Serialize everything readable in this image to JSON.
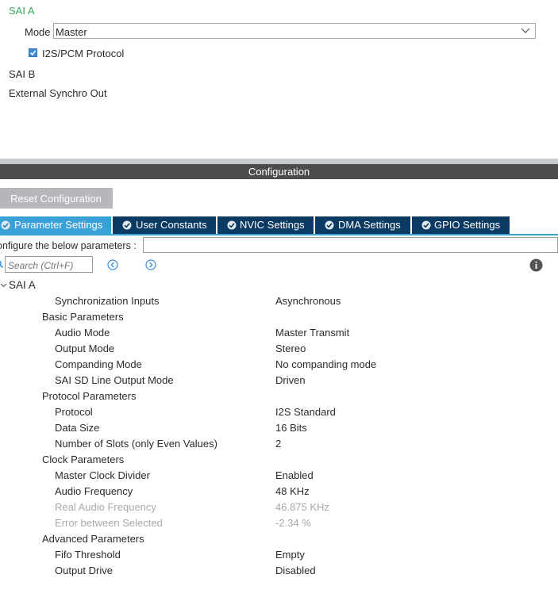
{
  "mode_panel": {
    "title": "SAI A",
    "mode_label": "Mode",
    "mode_value": "Master",
    "protocol_checkbox_label": "I2S/PCM Protocol",
    "protocol_checked": true,
    "sai_b": "SAI B",
    "external_sync": "External Synchro Out"
  },
  "config_bar": {
    "title": "Configuration"
  },
  "reset_button": "Reset Configuration",
  "tabs": [
    {
      "label": "Parameter Settings",
      "active": true
    },
    {
      "label": "User Constants",
      "active": false
    },
    {
      "label": "NVIC Settings",
      "active": false
    },
    {
      "label": "DMA Settings",
      "active": false
    },
    {
      "label": "GPIO Settings",
      "active": false
    }
  ],
  "configure_text": "onfigure the below parameters :",
  "search": {
    "placeholder": "Search (Ctrl+F)"
  },
  "tree": {
    "root": "SAI A",
    "rows": [
      {
        "label": "Synchronization Inputs",
        "value": "Asynchronous",
        "level": 2,
        "disabled": false
      },
      {
        "label": "Basic Parameters",
        "value": "",
        "level": 1,
        "disabled": false
      },
      {
        "label": "Audio Mode",
        "value": "Master Transmit",
        "level": 2,
        "disabled": false
      },
      {
        "label": "Output Mode",
        "value": "Stereo",
        "level": 2,
        "disabled": false
      },
      {
        "label": "Companding Mode",
        "value": "No companding mode",
        "level": 2,
        "disabled": false
      },
      {
        "label": "SAI SD Line Output Mode",
        "value": "Driven",
        "level": 2,
        "disabled": false
      },
      {
        "label": "Protocol Parameters",
        "value": "",
        "level": 1,
        "disabled": false
      },
      {
        "label": "Protocol",
        "value": "I2S Standard",
        "level": 2,
        "disabled": false
      },
      {
        "label": "Data Size",
        "value": "16 Bits",
        "level": 2,
        "disabled": false
      },
      {
        "label": "Number of Slots (only Even Values)",
        "value": "2",
        "level": 2,
        "disabled": false
      },
      {
        "label": "Clock Parameters",
        "value": "",
        "level": 1,
        "disabled": false
      },
      {
        "label": "Master Clock Divider",
        "value": "Enabled",
        "level": 2,
        "disabled": false
      },
      {
        "label": "Audio Frequency",
        "value": "48 KHz",
        "level": 2,
        "disabled": false
      },
      {
        "label": "Real Audio Frequency",
        "value": "46.875 KHz",
        "level": 2,
        "disabled": true
      },
      {
        "label": "Error between Selected",
        "value": "-2.34 %",
        "level": 2,
        "disabled": true
      },
      {
        "label": "Advanced Parameters",
        "value": "",
        "level": 1,
        "disabled": false
      },
      {
        "label": "Fifo Threshold",
        "value": "Empty",
        "level": 2,
        "disabled": false
      },
      {
        "label": "Output Drive",
        "value": "Disabled",
        "level": 2,
        "disabled": false
      }
    ]
  },
  "colors": {
    "accent_green": "#3aa75a",
    "tab_active": "#3aa0d8",
    "tab_inactive": "#0b3a63",
    "config_bar": "#4a4c4e"
  }
}
